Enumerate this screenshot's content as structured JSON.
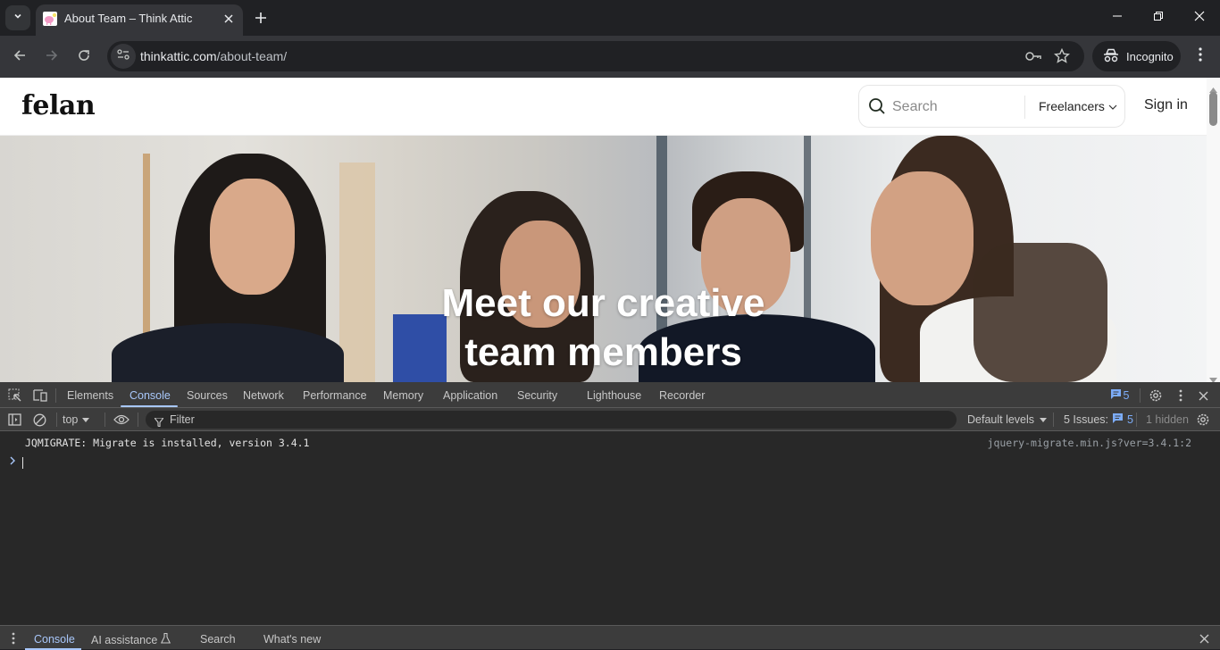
{
  "browser": {
    "tab": {
      "title": "About Team – Think Attic",
      "favicon": "brain-lightbulb-favicon"
    },
    "new_tab_label": "+",
    "url": {
      "domain": "thinkattic.com",
      "path": "/about-team/"
    },
    "incognito_label": "Incognito",
    "window_controls": [
      "minimize",
      "restore",
      "close"
    ]
  },
  "site": {
    "logo": "felan",
    "search": {
      "placeholder": "Search",
      "category": "Freelancers"
    },
    "signin_label": "Sign in",
    "hero": {
      "line1": "Meet our creative",
      "line2": "team members"
    }
  },
  "devtools": {
    "tabs": [
      "Elements",
      "Console",
      "Sources",
      "Network",
      "Performance",
      "Memory",
      "Application",
      "Security",
      "Lighthouse",
      "Recorder"
    ],
    "active_tab": "Console",
    "issues_badge": "5",
    "context": "top",
    "filter_placeholder": "Filter",
    "levels": "Default levels",
    "issues_label": "5 Issues:",
    "issues_count": "5",
    "hidden_label": "1 hidden",
    "console": {
      "messages": [
        {
          "text": "JQMIGRATE: Migrate is installed, version 3.4.1",
          "source": "jquery-migrate.min.js?ver=3.4.1:2"
        }
      ],
      "prompt": ">"
    },
    "drawer_tabs": [
      "Console",
      "AI assistance",
      "Search",
      "What's new"
    ],
    "drawer_active": "Console"
  },
  "colors": {
    "accent": "#a8c7fa",
    "issue_blue": "#7cacf8",
    "chrome_bg": "#202124"
  }
}
